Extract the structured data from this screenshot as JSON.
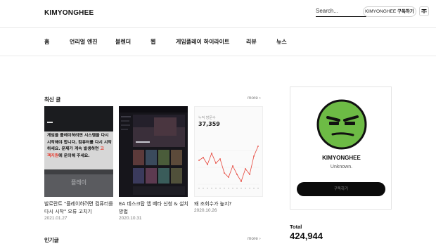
{
  "header": {
    "logo": "KIMYONGHEE",
    "search_placeholder": "Search...",
    "subscribe_pill": {
      "name": "KIMYONGHEE",
      "action": "구독하기"
    }
  },
  "nav": {
    "items": [
      "홈",
      "언리얼 엔진",
      "블렌더",
      "웹",
      "게임플레이 하이라이트",
      "리뷰",
      "뉴스"
    ]
  },
  "recent": {
    "title": "최신 글",
    "more": "more ›",
    "cards": [
      {
        "title": "발로란트 \"플레이하려면 컴퓨터를 다시 시작\" 오류 고치기",
        "date": "2021.01.27",
        "thumb_text": {
          "line1": "게임을 플레이하려면 시스템을 다시",
          "line2": "시작해야 합니다. 컴퓨터를 다시 시작",
          "line3a": "하세요. 문제가 계속 발생하면 ",
          "line3b": "고",
          "line4a": "객지원",
          "line4b": "에 문의해 주세요.",
          "button": "플레이"
        }
      },
      {
        "title": "EA 데스크탑 앱 베타 신청 & 설치 방법",
        "date": "2020.10.31"
      },
      {
        "title": "왜 조회수가 높지?",
        "date": "2020.10.26",
        "thumb_text": {
          "label": "누적 방문수",
          "value": "37,359"
        }
      }
    ]
  },
  "popular": {
    "title": "인기글",
    "more": "more ›"
  },
  "profile": {
    "name": "KIMYONGHEE",
    "description": "Unknown.",
    "button": "구독하기",
    "avatar_color": "#6dbb45"
  },
  "stats": {
    "total_label": "Total",
    "total_value": "424,944"
  },
  "colors": {
    "accent_text": "#e8382b",
    "button_bg": "#0b0b0b",
    "chart_line": "#e6453a"
  }
}
